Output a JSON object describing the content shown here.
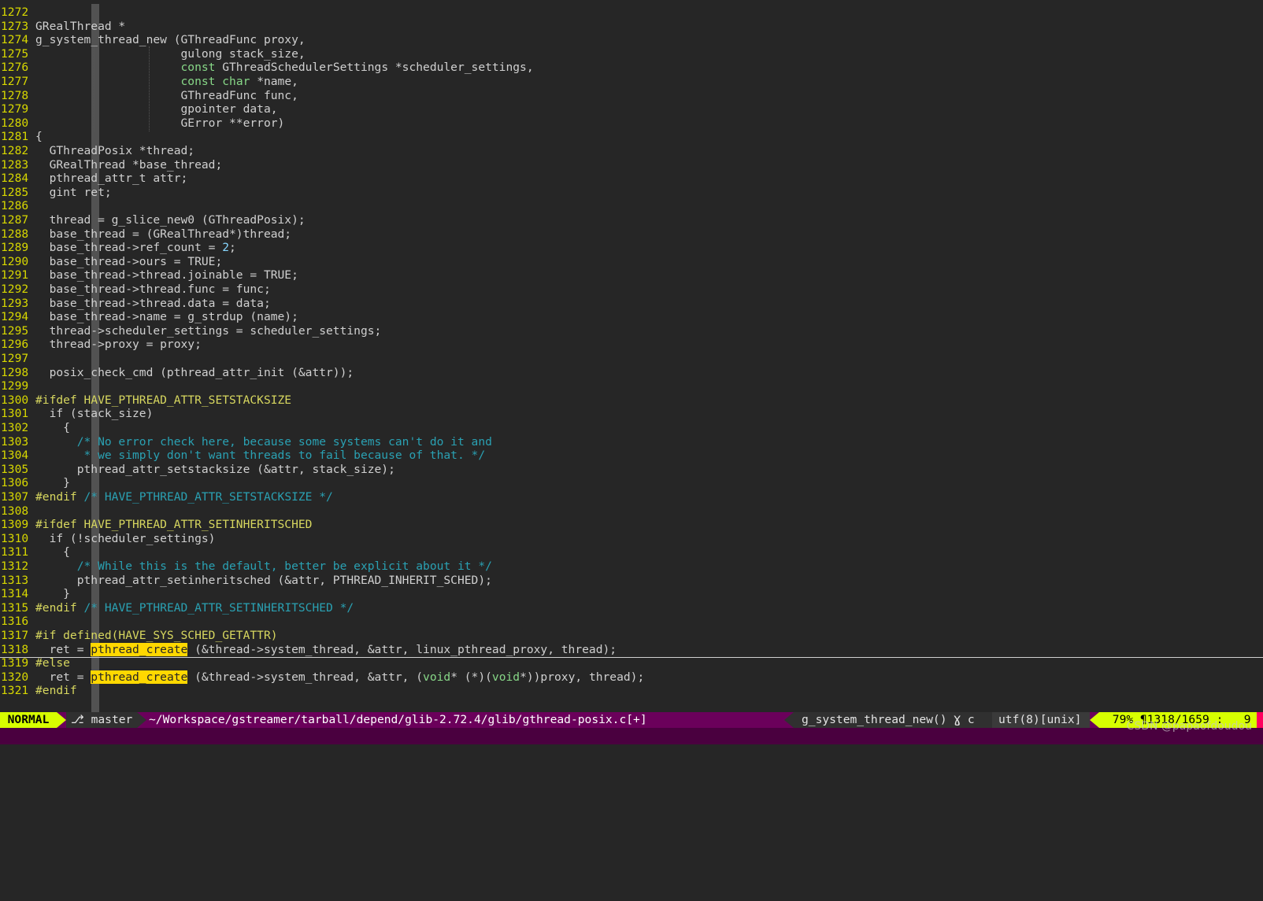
{
  "editor": {
    "lines": [
      {
        "n": "1272",
        "html": ""
      },
      {
        "n": "1273",
        "html": "GRealThread *"
      },
      {
        "n": "1274",
        "html": "g_system_thread_new (GThreadFunc proxy,"
      },
      {
        "n": "1275",
        "html": "                     gulong stack_size,"
      },
      {
        "n": "1276",
        "html": "                     <span class=\"hl-kw\">const</span> GThreadSchedulerSettings *scheduler_settings,"
      },
      {
        "n": "1277",
        "html": "                     <span class=\"hl-kw\">const</span> <span class=\"hl-kw\">char</span> *name,"
      },
      {
        "n": "1278",
        "html": "                     GThreadFunc func,"
      },
      {
        "n": "1279",
        "html": "                     gpointer data,"
      },
      {
        "n": "1280",
        "html": "                     GError **error)"
      },
      {
        "n": "1281",
        "html": "{"
      },
      {
        "n": "1282",
        "html": "  GThreadPosix *thread;"
      },
      {
        "n": "1283",
        "html": "  GRealThread *base_thread;"
      },
      {
        "n": "1284",
        "html": "  pthread_attr_t attr;"
      },
      {
        "n": "1285",
        "html": "  gint ret;"
      },
      {
        "n": "1286",
        "html": ""
      },
      {
        "n": "1287",
        "html": "  thread = g_slice_new0 (GThreadPosix);"
      },
      {
        "n": "1288",
        "html": "  base_thread = (GRealThread*)thread;"
      },
      {
        "n": "1289",
        "html": "  base_thread->ref_count = <span class=\"hl-num\">2</span>;"
      },
      {
        "n": "1290",
        "html": "  base_thread->ours = TRUE;"
      },
      {
        "n": "1291",
        "html": "  base_thread->thread.joinable = TRUE;"
      },
      {
        "n": "1292",
        "html": "  base_thread->thread.func = func;"
      },
      {
        "n": "1293",
        "html": "  base_thread->thread.data = data;"
      },
      {
        "n": "1294",
        "html": "  base_thread->name = g_strdup (name);"
      },
      {
        "n": "1295",
        "html": "  thread->scheduler_settings = scheduler_settings;"
      },
      {
        "n": "1296",
        "html": "  thread->proxy = proxy;"
      },
      {
        "n": "1297",
        "html": ""
      },
      {
        "n": "1298",
        "html": "  posix_check_cmd (pthread_attr_init (&amp;attr));"
      },
      {
        "n": "1299",
        "html": ""
      },
      {
        "n": "1300",
        "html": "<span class=\"hl-pp\">#ifdef HAVE_PTHREAD_ATTR_SETSTACKSIZE</span>"
      },
      {
        "n": "1301",
        "html": "  if (stack_size)"
      },
      {
        "n": "1302",
        "html": "    {"
      },
      {
        "n": "1303",
        "html": "      <span class=\"hl-cm\">/* No error check here, because some systems can't do it and</span>"
      },
      {
        "n": "1304",
        "html": "<span class=\"hl-cm\">       * we simply don't want threads to fail because of that. */</span>"
      },
      {
        "n": "1305",
        "html": "      pthread_attr_setstacksize (&amp;attr, stack_size);"
      },
      {
        "n": "1306",
        "html": "    }"
      },
      {
        "n": "1307",
        "html": "<span class=\"hl-pp\">#endif</span> <span class=\"hl-cm\">/* HAVE_PTHREAD_ATTR_SETSTACKSIZE */</span>"
      },
      {
        "n": "1308",
        "html": ""
      },
      {
        "n": "1309",
        "html": "<span class=\"hl-pp\">#ifdef HAVE_PTHREAD_ATTR_SETINHERITSCHED</span>"
      },
      {
        "n": "1310",
        "html": "  if (!scheduler_settings)"
      },
      {
        "n": "1311",
        "html": "    {"
      },
      {
        "n": "1312",
        "html": "      <span class=\"hl-cm\">/* While this is the default, better be explicit about it */</span>"
      },
      {
        "n": "1313",
        "html": "      pthread_attr_setinheritsched (&amp;attr, PTHREAD_INHERIT_SCHED);"
      },
      {
        "n": "1314",
        "html": "    }"
      },
      {
        "n": "1315",
        "html": "<span class=\"hl-pp\">#endif</span> <span class=\"hl-cm\">/* HAVE_PTHREAD_ATTR_SETINHERITSCHED */</span>"
      },
      {
        "n": "1316",
        "html": ""
      },
      {
        "n": "1317",
        "html": "<span class=\"hl-pp\">#if defined(HAVE_SYS_SCHED_GETATTR)</span>"
      },
      {
        "n": "1318",
        "html": "  ret = <span class=\"hl-search\">pthread_create</span> (&amp;thread->system_thread, &amp;attr, linux_pthread_proxy, thread);",
        "cursor": true
      },
      {
        "n": "1319",
        "html": "<span class=\"hl-pp\">#else</span>"
      },
      {
        "n": "1320",
        "html": "  ret = <span class=\"hl-search\">pthread_create</span> (&amp;thread->system_thread, &amp;attr, (<span class=\"hl-kw\">void</span>* (*)(<span class=\"hl-kw\">void</span>*))proxy, thread);"
      },
      {
        "n": "1321",
        "html": "<span class=\"hl-pp\">#endif</span>"
      }
    ]
  },
  "statusline": {
    "mode": "NORMAL",
    "branch": "⎇ master",
    "filepath": "~/Workspace/gstreamer/tarball/depend/glib-2.72.4/glib/gthread-posix.c[+]",
    "function": "g_system_thread_new() Ɣ c",
    "encoding": "utf(8)[unix]",
    "position": " 79% ¶1318/1659 :   9"
  },
  "watermark": "CSDN @papaofdoudou",
  "colors": {
    "background": "#262626",
    "line_number": "#d7d700",
    "keyword": "#87d787",
    "preprocessor": "#d7d75f",
    "comment": "#2aa1b3",
    "search_highlight": "#ffd800",
    "statusbar": "#6b005b",
    "mode_bg": "#d7ff00"
  }
}
